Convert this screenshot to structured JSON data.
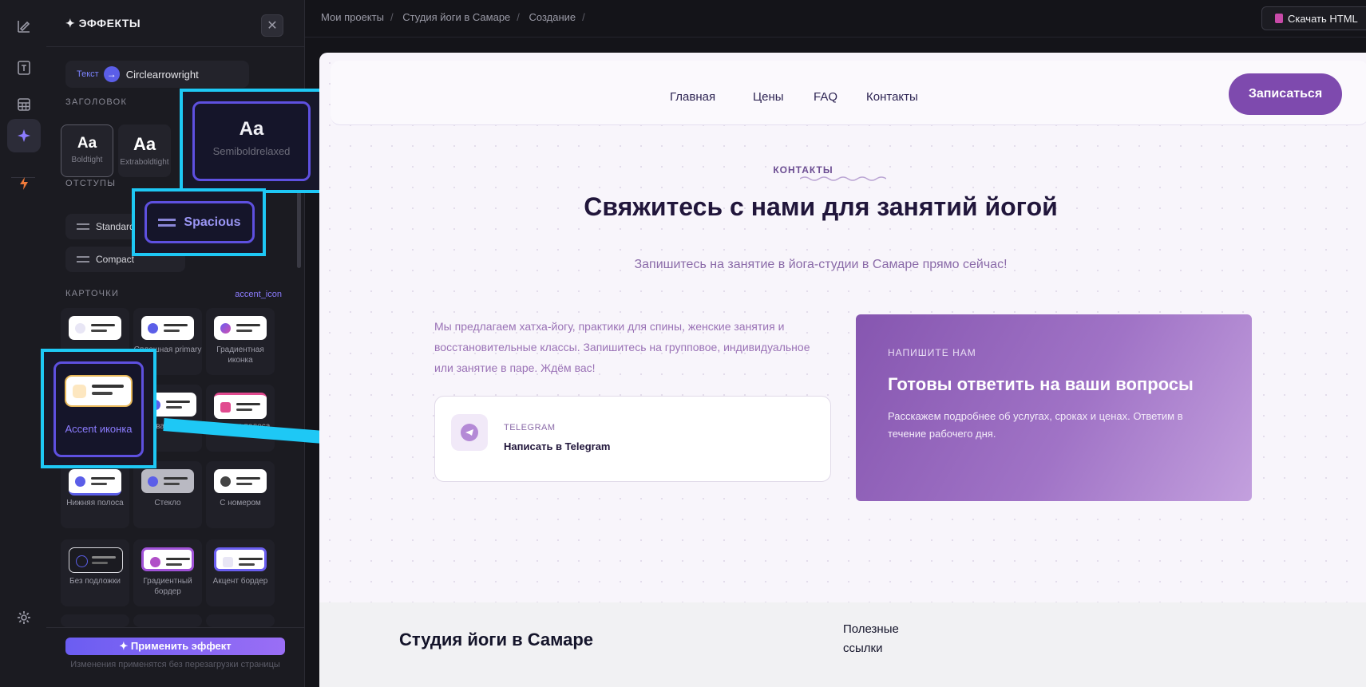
{
  "panel": {
    "title": "✦ ЭФФЕКТЫ",
    "close_icon": "close-icon",
    "text_chip": {
      "tag": "Текст",
      "arrow": "→",
      "label": "Circlearrowright"
    },
    "heading_section": "ЗАГОЛОВОК",
    "heading_tiles": [
      {
        "aa": "Aa",
        "label": "Boldtight"
      },
      {
        "aa": "Aa",
        "label": "Extraboldtight"
      }
    ],
    "spacing_section": "ОТСТУПЫ",
    "spacing_selected_tail": "ous",
    "spacing_options": [
      "Standard",
      "Compact"
    ],
    "cards_section": "КАРТОЧКИ",
    "cards_selected": "accent_icon",
    "card_tiles": [
      {
        "label": "",
        "dot": "#e8e6f5"
      },
      {
        "label": "Сплошная primary",
        "dot": "#5b5ee8"
      },
      {
        "label": "Градиентная иконка",
        "dot": "#b04fc8"
      },
      {
        "label": "Боковая полоса",
        "dot": "#5b5ee8"
      },
      {
        "label": "Верхняя полоса",
        "dot": "#e14a8f"
      },
      {
        "label": "Нижняя полоса",
        "dot": "#5b5ee8"
      },
      {
        "label": "Стекло",
        "dot": "#5b5ee8"
      },
      {
        "label": "С номером",
        "dot": "#444"
      },
      {
        "label": "Без подложки",
        "dot": "#5b5ee8"
      },
      {
        "label": "Градиентный бордер",
        "dot": "#b04fc8"
      },
      {
        "label": "Акцент бордер",
        "dot": "#e8e6f5"
      }
    ],
    "apply_button": "✦ Применить эффект",
    "apply_note": "Изменения применятся без перезагрузки страницы"
  },
  "callouts": {
    "heading": {
      "aa": "Aa",
      "label": "Semiboldrelaxed"
    },
    "spacing": {
      "label": "Spacious"
    },
    "card": {
      "label": "Accent иконка"
    }
  },
  "topbar": {
    "breadcrumbs": [
      "Мои проекты",
      "Студия йоги в Самаре",
      "Создание"
    ],
    "download_button": "Скачать HTML"
  },
  "site": {
    "nav_links": [
      "Главная",
      "Цены",
      "FAQ",
      "Контакты"
    ],
    "cta": "Записаться",
    "eyebrow": "КОНТАКТЫ",
    "heading": "Свяжитесь с нами для занятий йогой",
    "lead": "Запишитесь на занятие в йога-студии в Самаре прямо сейчас!",
    "paragraph": "Мы предлагаем хатха-йогу, практики для спины, женские занятия и восстановительные классы. Запишитесь на групповое, индивидуальное или занятие в паре. Ждём вас!",
    "telegram": {
      "label": "TELEGRAM",
      "text": "Написать в Telegram"
    },
    "contact_box": {
      "kicker": "НАПИШИТЕ НАМ",
      "title": "Готовы ответить на ваши вопросы",
      "desc": "Расскажем подробнее об услугах, сроках и ценах. Ответим в течение рабочего дня."
    },
    "footer": {
      "brand": "Студия йоги в Самаре",
      "links_title": "Полезные ссылки"
    }
  },
  "colors": {
    "accent": "#7e4aae",
    "callout": "#1ec8f5",
    "panel_bg": "#1b1b21"
  }
}
